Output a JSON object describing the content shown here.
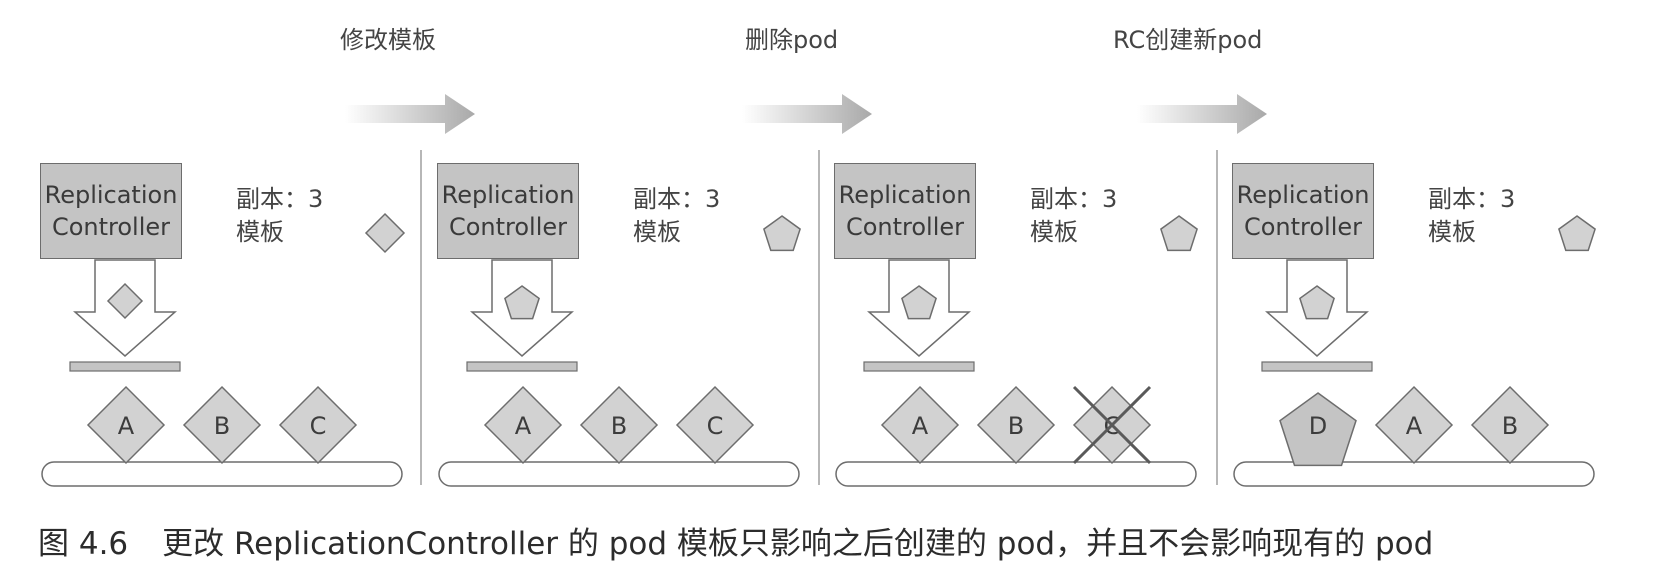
{
  "steps": [
    "修改模板",
    "删除pod",
    "RC创建新pod"
  ],
  "panels": [
    {
      "controller_line1": "Replication",
      "controller_line2": "Controller",
      "replicas": "副本：3",
      "template": "模板",
      "template_shape": "diamond",
      "pods": [
        "A",
        "B",
        "C"
      ],
      "deleted_pod": ""
    },
    {
      "controller_line1": "Replication",
      "controller_line2": "Controller",
      "replicas": "副本：3",
      "template": "模板",
      "template_shape": "pentagon",
      "pods": [
        "A",
        "B",
        "C"
      ],
      "deleted_pod": ""
    },
    {
      "controller_line1": "Replication",
      "controller_line2": "Controller",
      "replicas": "副本：3",
      "template": "模板",
      "template_shape": "pentagon",
      "pods": [
        "A",
        "B",
        "C"
      ],
      "deleted_pod": "C"
    },
    {
      "controller_line1": "Replication",
      "controller_line2": "Controller",
      "replicas": "副本：3",
      "template": "模板",
      "template_shape": "pentagon",
      "pods": [
        "D",
        "A",
        "B"
      ],
      "new_pod": "D",
      "deleted_pod": ""
    }
  ],
  "caption": {
    "figure": "图 4.6",
    "text": "更改 ReplicationController 的 pod 模板只影响之后创建的 pod，并且不会影响现有的 pod"
  },
  "colors": {
    "box_fill": "#c4c4c4",
    "pod_fill": "#d2d2d2",
    "stroke": "#6d6d6d",
    "arrow": "#b4b4b4"
  }
}
